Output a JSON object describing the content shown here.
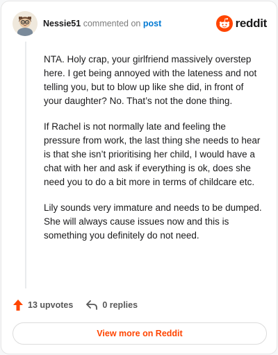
{
  "header": {
    "username": "Nessie51",
    "action_text": "commented on",
    "post_link": "post",
    "brand_wordmark": "reddit"
  },
  "comment": {
    "paragraphs": [
      "NTA. Holy crap, your girlfriend massively overstep here. I get being annoyed with the lateness and not telling you, but to blow up like she did, in front of your daughter? No. That’s not the done thing.",
      "If Rachel is not normally late and feeling the pressure from work, the last thing she needs to hear is that she isn’t prioritising her child, I would have a chat with her and ask if everything is ok, does she need you to do a bit more in terms of childcare etc.",
      "Lily sounds very immature and needs to be dumped. She will always cause issues now and this is something you definitely do not need."
    ]
  },
  "footer": {
    "upvotes": "13 upvotes",
    "replies": "0 replies",
    "cta": "View more on Reddit"
  },
  "icons": {
    "upvote": "upvote-arrow-icon",
    "reply": "reply-arrow-icon",
    "brand": "reddit-snoo-icon"
  },
  "colors": {
    "accent": "#ff4500",
    "link": "#0079d3"
  }
}
